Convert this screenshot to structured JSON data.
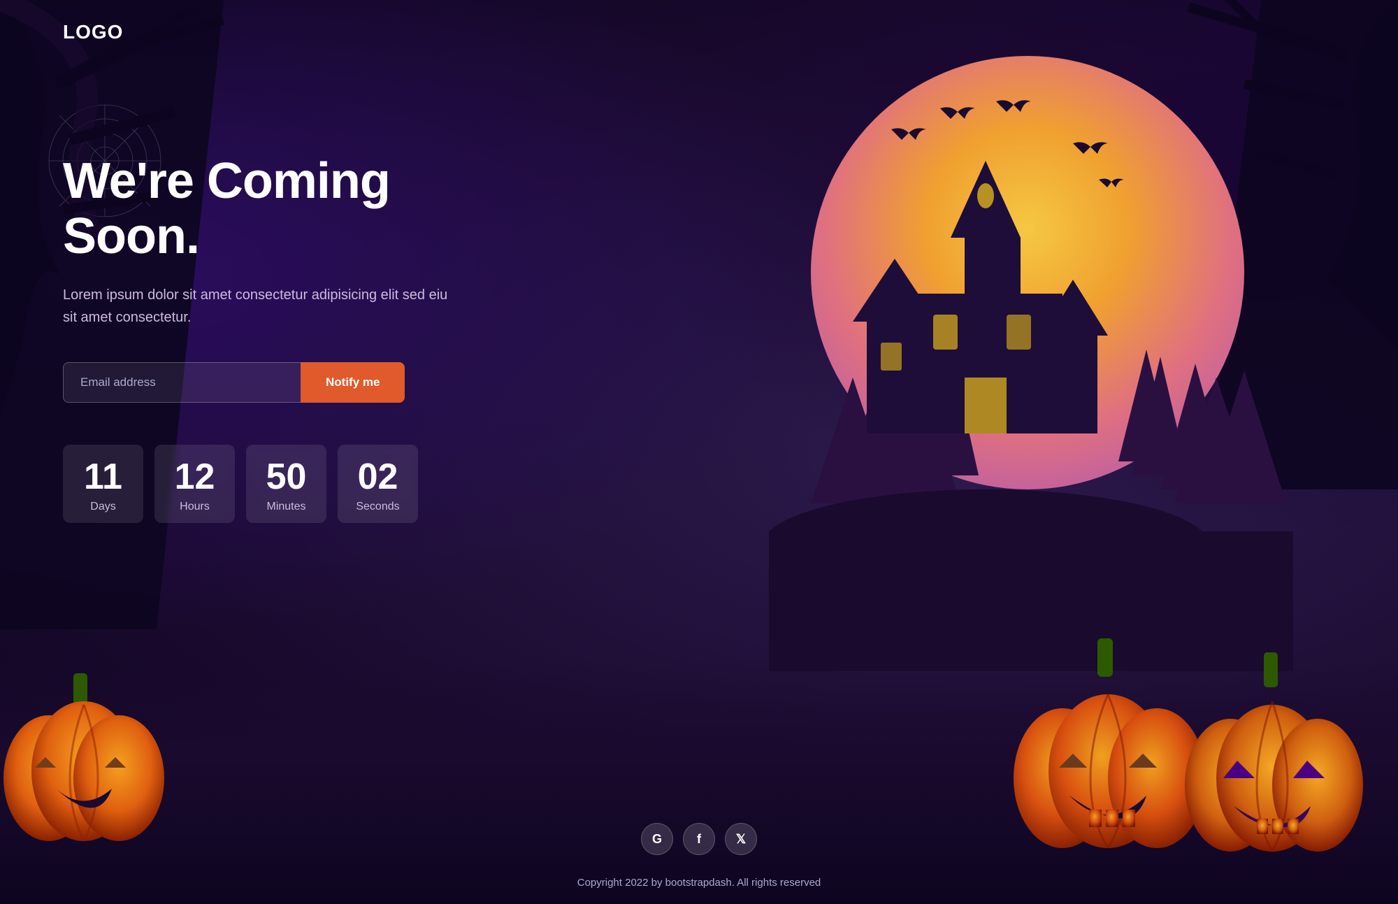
{
  "logo": "LOGO",
  "headline": "We're Coming Soon.",
  "subtext": "Lorem ipsum dolor sit amet consectetur adipisicing elit sed eiu sit amet consectetur.",
  "email_placeholder": "Email address",
  "notify_button": "Notify me",
  "countdown": [
    {
      "value": "11",
      "label": "Days"
    },
    {
      "value": "12",
      "label": "Hours"
    },
    {
      "value": "50",
      "label": "Minutes"
    },
    {
      "value": "02",
      "label": "Seconds"
    }
  ],
  "social": [
    {
      "name": "google",
      "symbol": "G"
    },
    {
      "name": "facebook",
      "symbol": "f"
    },
    {
      "name": "twitter",
      "symbol": "𝕏"
    }
  ],
  "copyright": "Copyright 2022 by bootstrapdash. All rights reserved",
  "colors": {
    "accent": "#e05a2b",
    "bg_dark": "#1a0a2e",
    "moon_center": "#f5c842",
    "moon_edge": "#c060a0"
  }
}
